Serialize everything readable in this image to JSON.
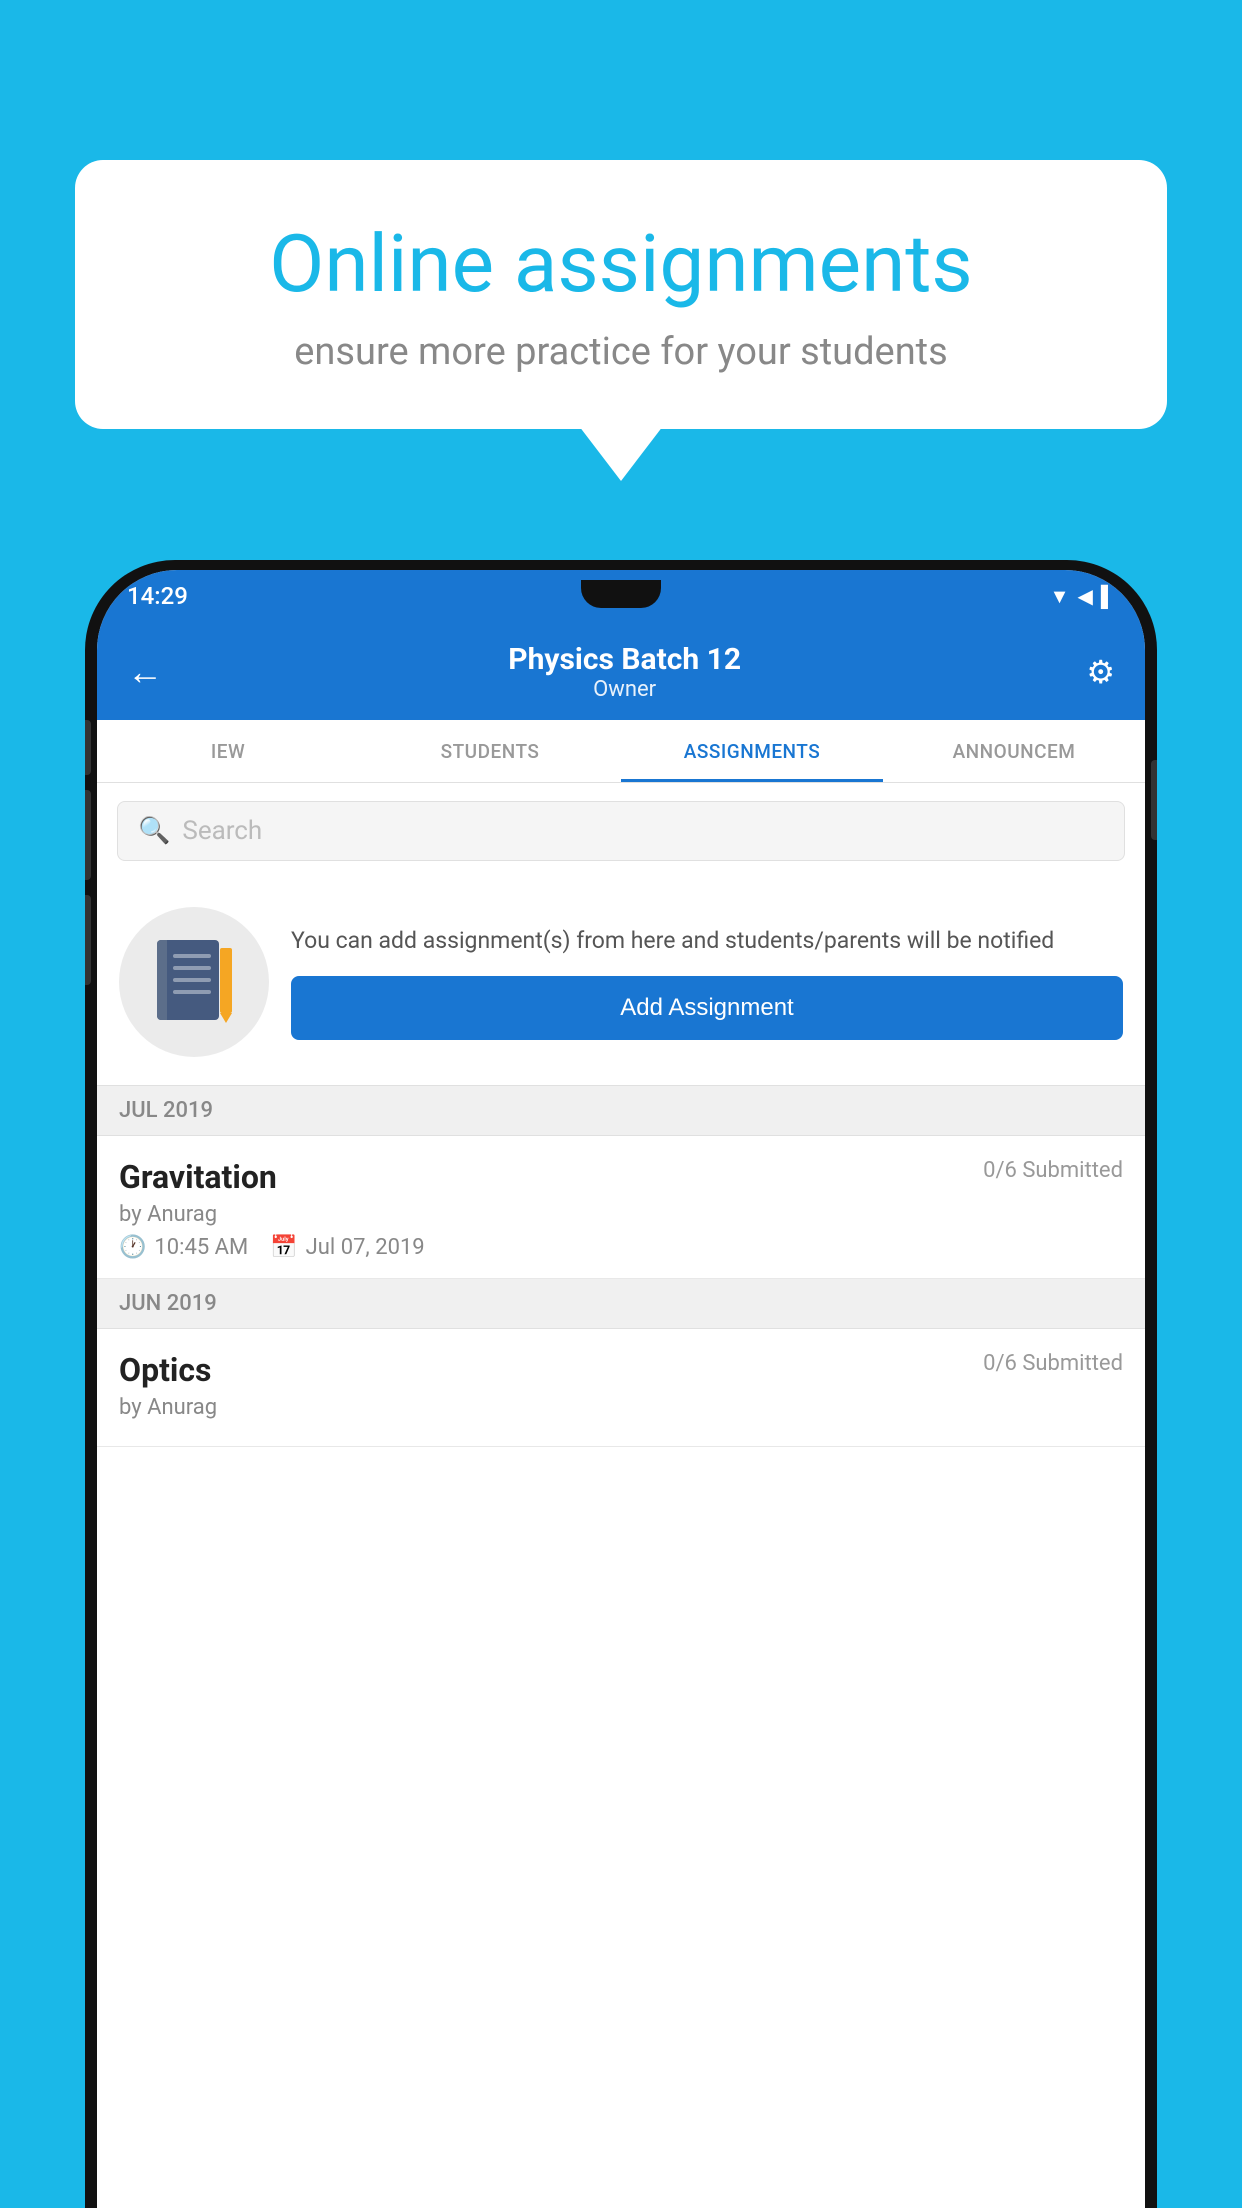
{
  "background_color": "#1AB8E8",
  "speech_bubble": {
    "title": "Online assignments",
    "subtitle": "ensure more practice for your students"
  },
  "phone": {
    "status_bar": {
      "time": "14:29",
      "icons": "▼◀▌"
    },
    "header": {
      "title": "Physics Batch 12",
      "subtitle": "Owner",
      "back_label": "←",
      "settings_label": "⚙"
    },
    "tabs": [
      {
        "label": "IEW",
        "active": false
      },
      {
        "label": "STUDENTS",
        "active": false
      },
      {
        "label": "ASSIGNMENTS",
        "active": true
      },
      {
        "label": "ANNOUNCEM",
        "active": false
      }
    ],
    "search": {
      "placeholder": "Search"
    },
    "add_assignment_section": {
      "description": "You can add assignment(s) from here and students/parents will be notified",
      "button_label": "Add Assignment"
    },
    "assignments": [
      {
        "month": "JUL 2019",
        "items": [
          {
            "name": "Gravitation",
            "submitted": "0/6 Submitted",
            "by": "by Anurag",
            "time": "10:45 AM",
            "date": "Jul 07, 2019"
          }
        ]
      },
      {
        "month": "JUN 2019",
        "items": [
          {
            "name": "Optics",
            "submitted": "0/6 Submitted",
            "by": "by Anurag",
            "time": "",
            "date": ""
          }
        ]
      }
    ]
  }
}
